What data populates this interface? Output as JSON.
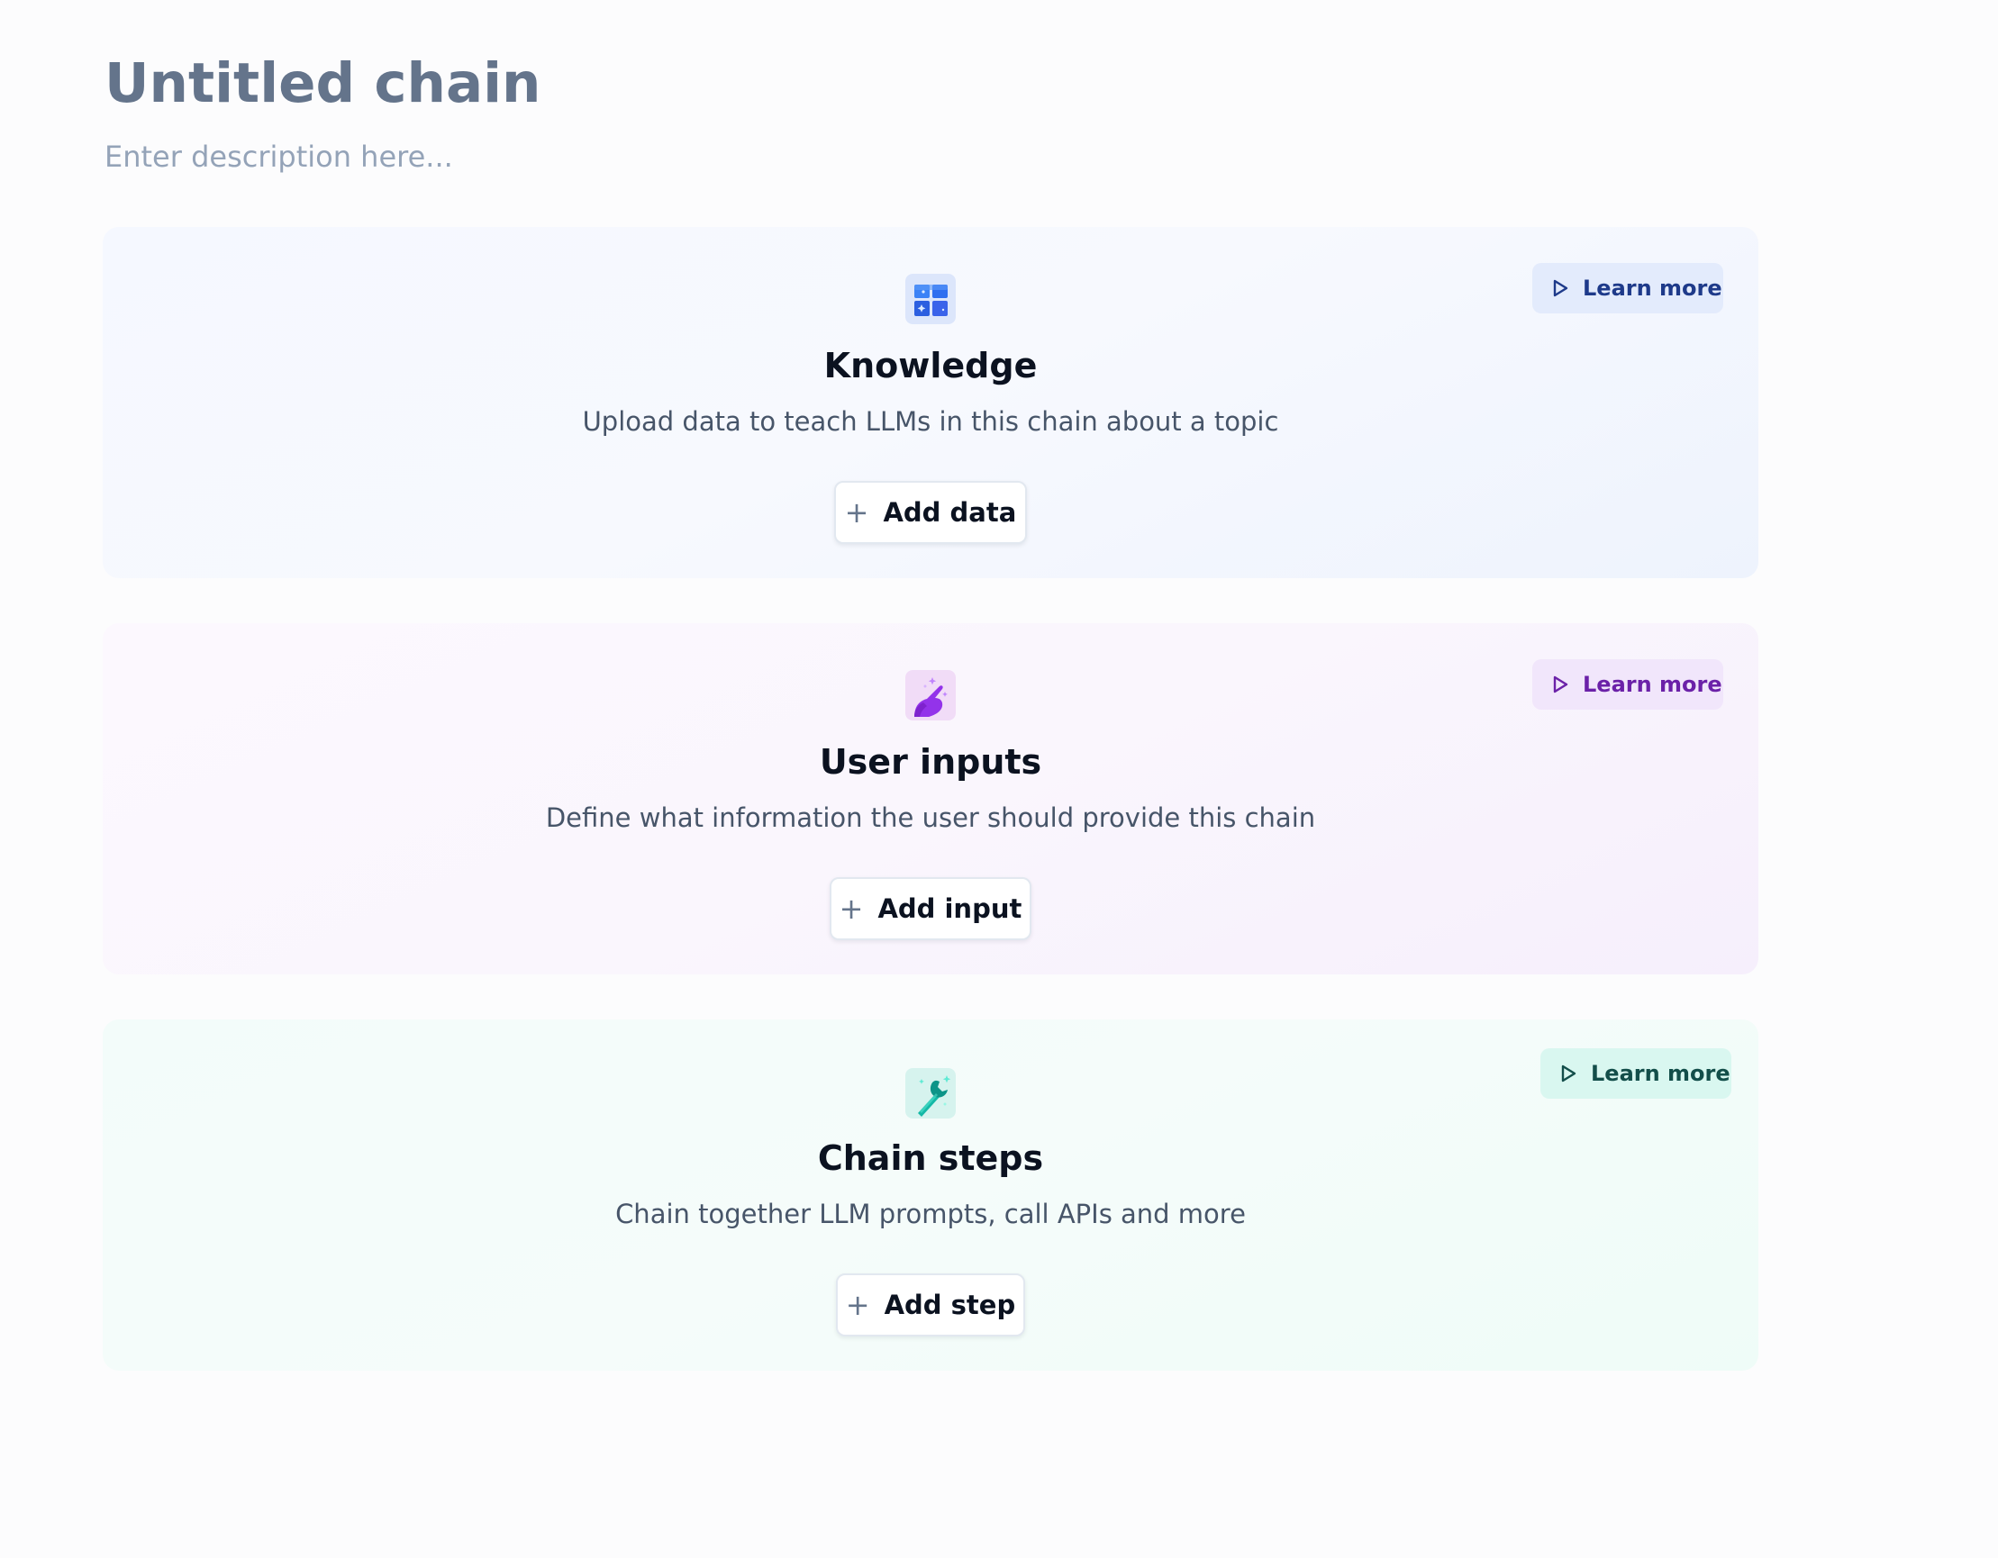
{
  "header": {
    "title": "Untitled chain",
    "description_placeholder": "Enter description here..."
  },
  "sections": [
    {
      "id": "knowledge",
      "title": "Knowledge",
      "subtitle": "Upload data to teach LLMs in this chain about a topic",
      "button_label": "Add data",
      "learn_more_label": "Learn more",
      "icon": "knowledge-grid-icon",
      "accent_color": "#2563eb"
    },
    {
      "id": "user-inputs",
      "title": "User inputs",
      "subtitle": "Define what information the user should provide this chain",
      "button_label": "Add input",
      "learn_more_label": "Learn more",
      "icon": "pointing-hand-sparkle-icon",
      "accent_color": "#7e22ce"
    },
    {
      "id": "chain-steps",
      "title": "Chain steps",
      "subtitle": "Chain together LLM prompts, call APIs and more",
      "button_label": "Add step",
      "learn_more_label": "Learn more",
      "icon": "wrench-sparkle-icon",
      "accent_color": "#0d9488"
    }
  ]
}
